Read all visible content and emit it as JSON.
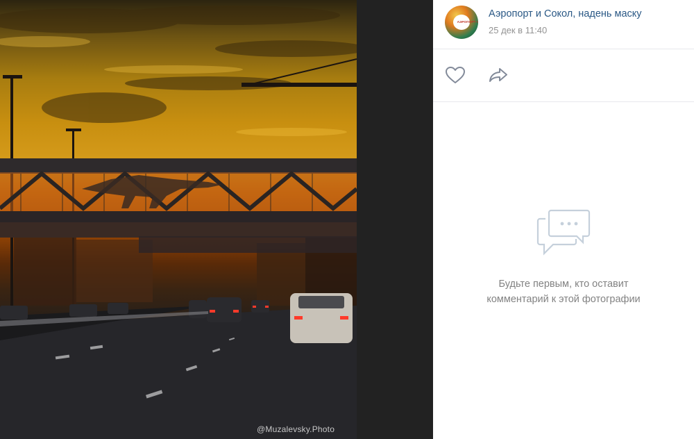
{
  "photo": {
    "watermark": "@Muzalevsky.Photo"
  },
  "post": {
    "author": "Аэропорт и Сокол, надень маску",
    "date": "25 дек в 11:40",
    "avatar_text": "АЭРОПОРТ СОКОЛ"
  },
  "actions": {
    "like_icon": "heart-icon",
    "share_icon": "share-icon"
  },
  "comments": {
    "empty_line1": "Будьте первым, кто оставит",
    "empty_line2": "комментарий к этой фотографии",
    "empty_icon": "comments-icon"
  },
  "colors": {
    "link": "#2a5885",
    "muted": "#939393",
    "icon": "#828a99",
    "background": "#222222"
  }
}
